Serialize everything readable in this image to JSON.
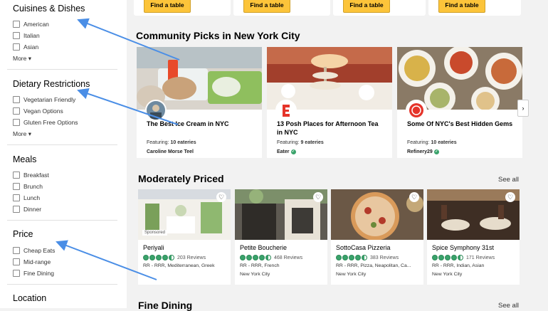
{
  "sidebar": {
    "cuisines": {
      "title": "Cuisines & Dishes",
      "options": [
        "American",
        "Italian",
        "Asian"
      ],
      "more": "More"
    },
    "dietary": {
      "title": "Dietary Restrictions",
      "options": [
        "Vegetarian Friendly",
        "Vegan Options",
        "Gluten Free Options"
      ],
      "more": "More"
    },
    "meals": {
      "title": "Meals",
      "options": [
        "Breakfast",
        "Brunch",
        "Lunch",
        "Dinner"
      ]
    },
    "price": {
      "title": "Price",
      "options": [
        "Cheap Eats",
        "Mid-range",
        "Fine Dining"
      ]
    },
    "location": {
      "title": "Location"
    }
  },
  "top": {
    "find_label": "Find a table"
  },
  "community": {
    "title": "Community Picks in New York City",
    "cards": [
      {
        "title": "The Best Ice Cream in NYC",
        "featuring_prefix": "Featuring: ",
        "featuring_count": "10 eateries",
        "source": "Caroline Morse Teel"
      },
      {
        "title": "13 Posh Places for Afternoon Tea in NYC",
        "featuring_prefix": "Featuring: ",
        "featuring_count": "9 eateries",
        "source": "Eater"
      },
      {
        "title": "Some Of NYC's Best Hidden Gems",
        "featuring_prefix": "Featuring: ",
        "featuring_count": "10 eateries",
        "source": "Refinery29"
      }
    ]
  },
  "moderate": {
    "title": "Moderately Priced",
    "see_all": "See all",
    "cards": [
      {
        "name": "Periyali",
        "reviews": "203 Reviews",
        "meta": "RR - RRR, Mediterranean, Greek",
        "city": "",
        "sponsored": "Sponsored",
        "rating": 4.5
      },
      {
        "name": "Petite Boucherie",
        "reviews": "468 Reviews",
        "meta": "RR - RRR, French",
        "city": "New York City",
        "rating": 4.5
      },
      {
        "name": "SottoCasa Pizzeria",
        "reviews": "383 Reviews",
        "meta": "RR - RRR, Pizza, Neapolitan, Ca...",
        "city": "New York City",
        "rating": 4.5
      },
      {
        "name": "Spice Symphony 31st",
        "reviews": "171 Reviews",
        "meta": "RR - RRR, Indian, Asian",
        "city": "New York City",
        "rating": 4.5
      }
    ]
  },
  "fine": {
    "title": "Fine Dining",
    "see_all": "See all"
  },
  "icons": {
    "heart": "heart-icon",
    "check": "verified-check-icon",
    "chevron": "chevron-right-icon",
    "caret": "caret-down-icon"
  },
  "colors": {
    "accent_yellow": "#fcc43a",
    "rating_green": "#3aa36b",
    "annotation_arrow": "#4a8ee6"
  }
}
